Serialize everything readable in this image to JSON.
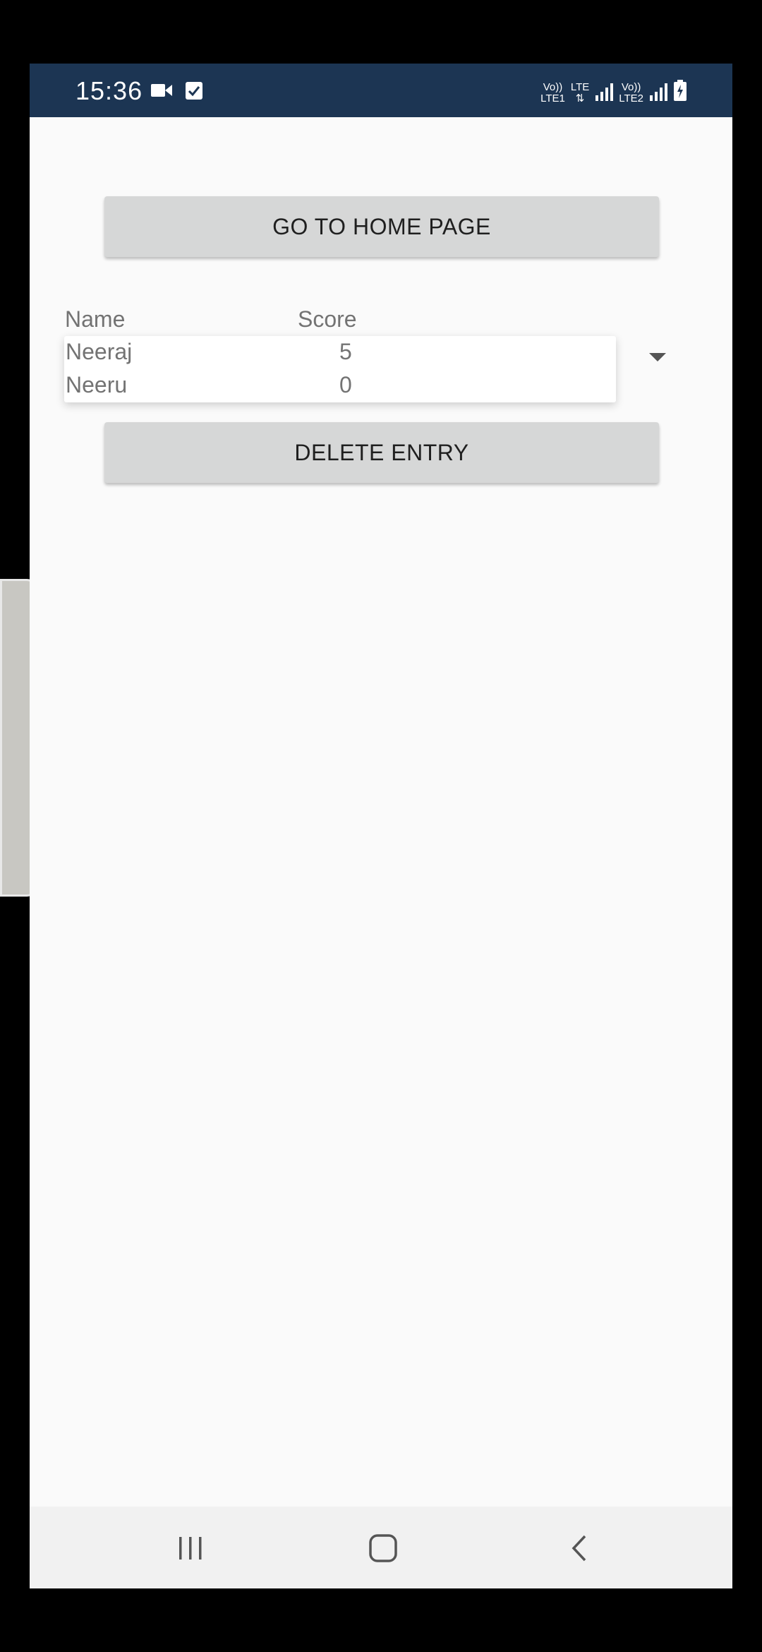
{
  "status_bar": {
    "time": "15:36",
    "icons": [
      "video-camera-icon",
      "task-check-icon",
      "volte-lte1-icon",
      "lte-data-icon",
      "signal-icon",
      "volte-lte2-icon",
      "signal-icon",
      "battery-charging-icon"
    ],
    "sim1_label_top": "Vo))",
    "sim1_label_bottom": "LTE1",
    "data_label": "LTE",
    "sim2_label_top": "Vo))",
    "sim2_label_bottom": "LTE2"
  },
  "buttons": {
    "home_label": "GO TO HOME PAGE",
    "delete_label": "DELETE ENTRY"
  },
  "table": {
    "headers": {
      "name": "Name",
      "score": "Score"
    },
    "rows": [
      {
        "name": "Neeraj",
        "score": "5"
      },
      {
        "name": "Neeru",
        "score": "0"
      }
    ]
  },
  "navigation": {
    "icons": [
      "recent-apps-icon",
      "home-icon",
      "back-icon"
    ]
  },
  "colors": {
    "status_bar": "#1c3553",
    "background": "#fafafa",
    "button": "#d6d7d7",
    "text_secondary": "#737373"
  }
}
